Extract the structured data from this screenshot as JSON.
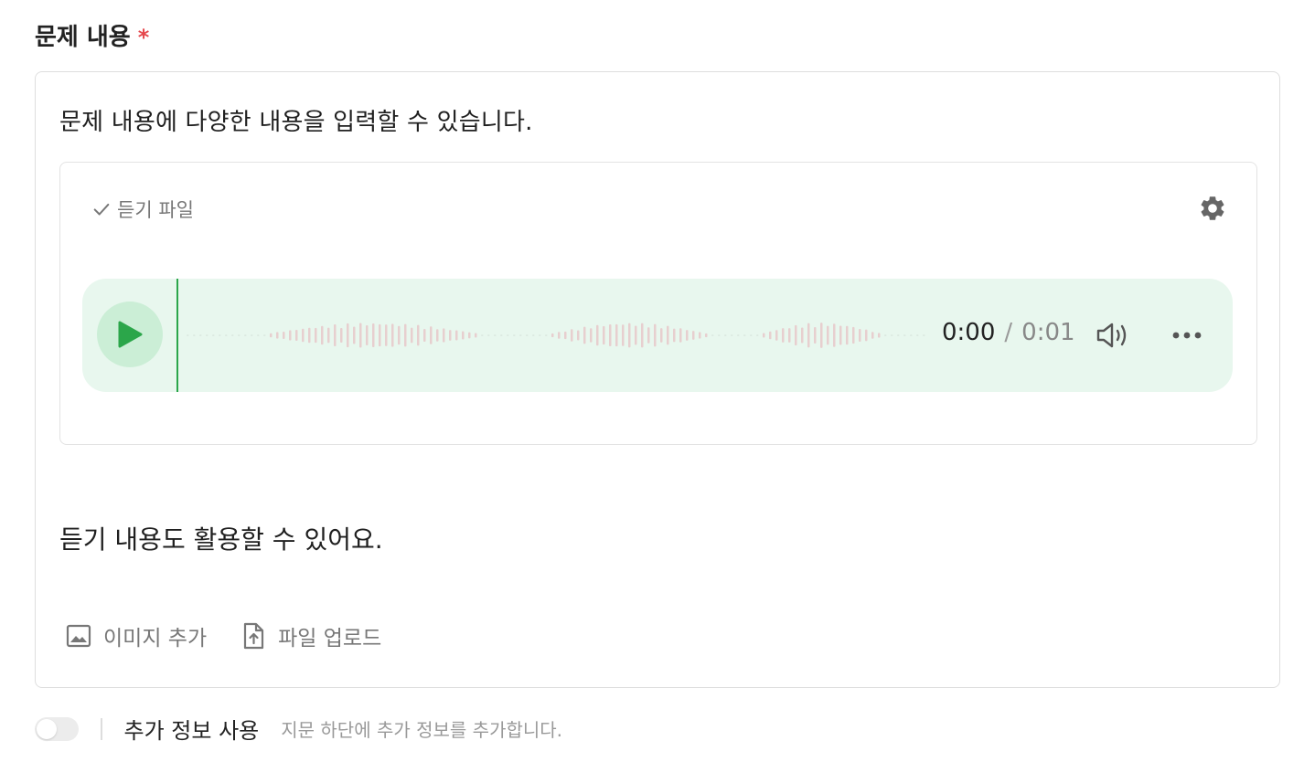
{
  "field": {
    "label": "문제 내용",
    "required_mark": "*"
  },
  "editor": {
    "intro_text": "문제 내용에 다양한 내용을 입력할 수 있습니다.",
    "audio": {
      "label": "듣기 파일",
      "current_time": "0:00",
      "separator": "/",
      "duration": "0:01",
      "progress": 0
    },
    "listen_text": "듣기 내용도 활용할 수 있어요.",
    "toolbar": {
      "add_image_label": "이미지 추가",
      "upload_file_label": "파일 업로드"
    }
  },
  "footer": {
    "toggle_on": false,
    "title": "추가 정보 사용",
    "description": "지문 하단에 추가 정보를 추가합니다."
  },
  "colors": {
    "accent_green": "#2ba64a",
    "player_bg": "#e8f7ee",
    "required_red": "#e5484d"
  }
}
